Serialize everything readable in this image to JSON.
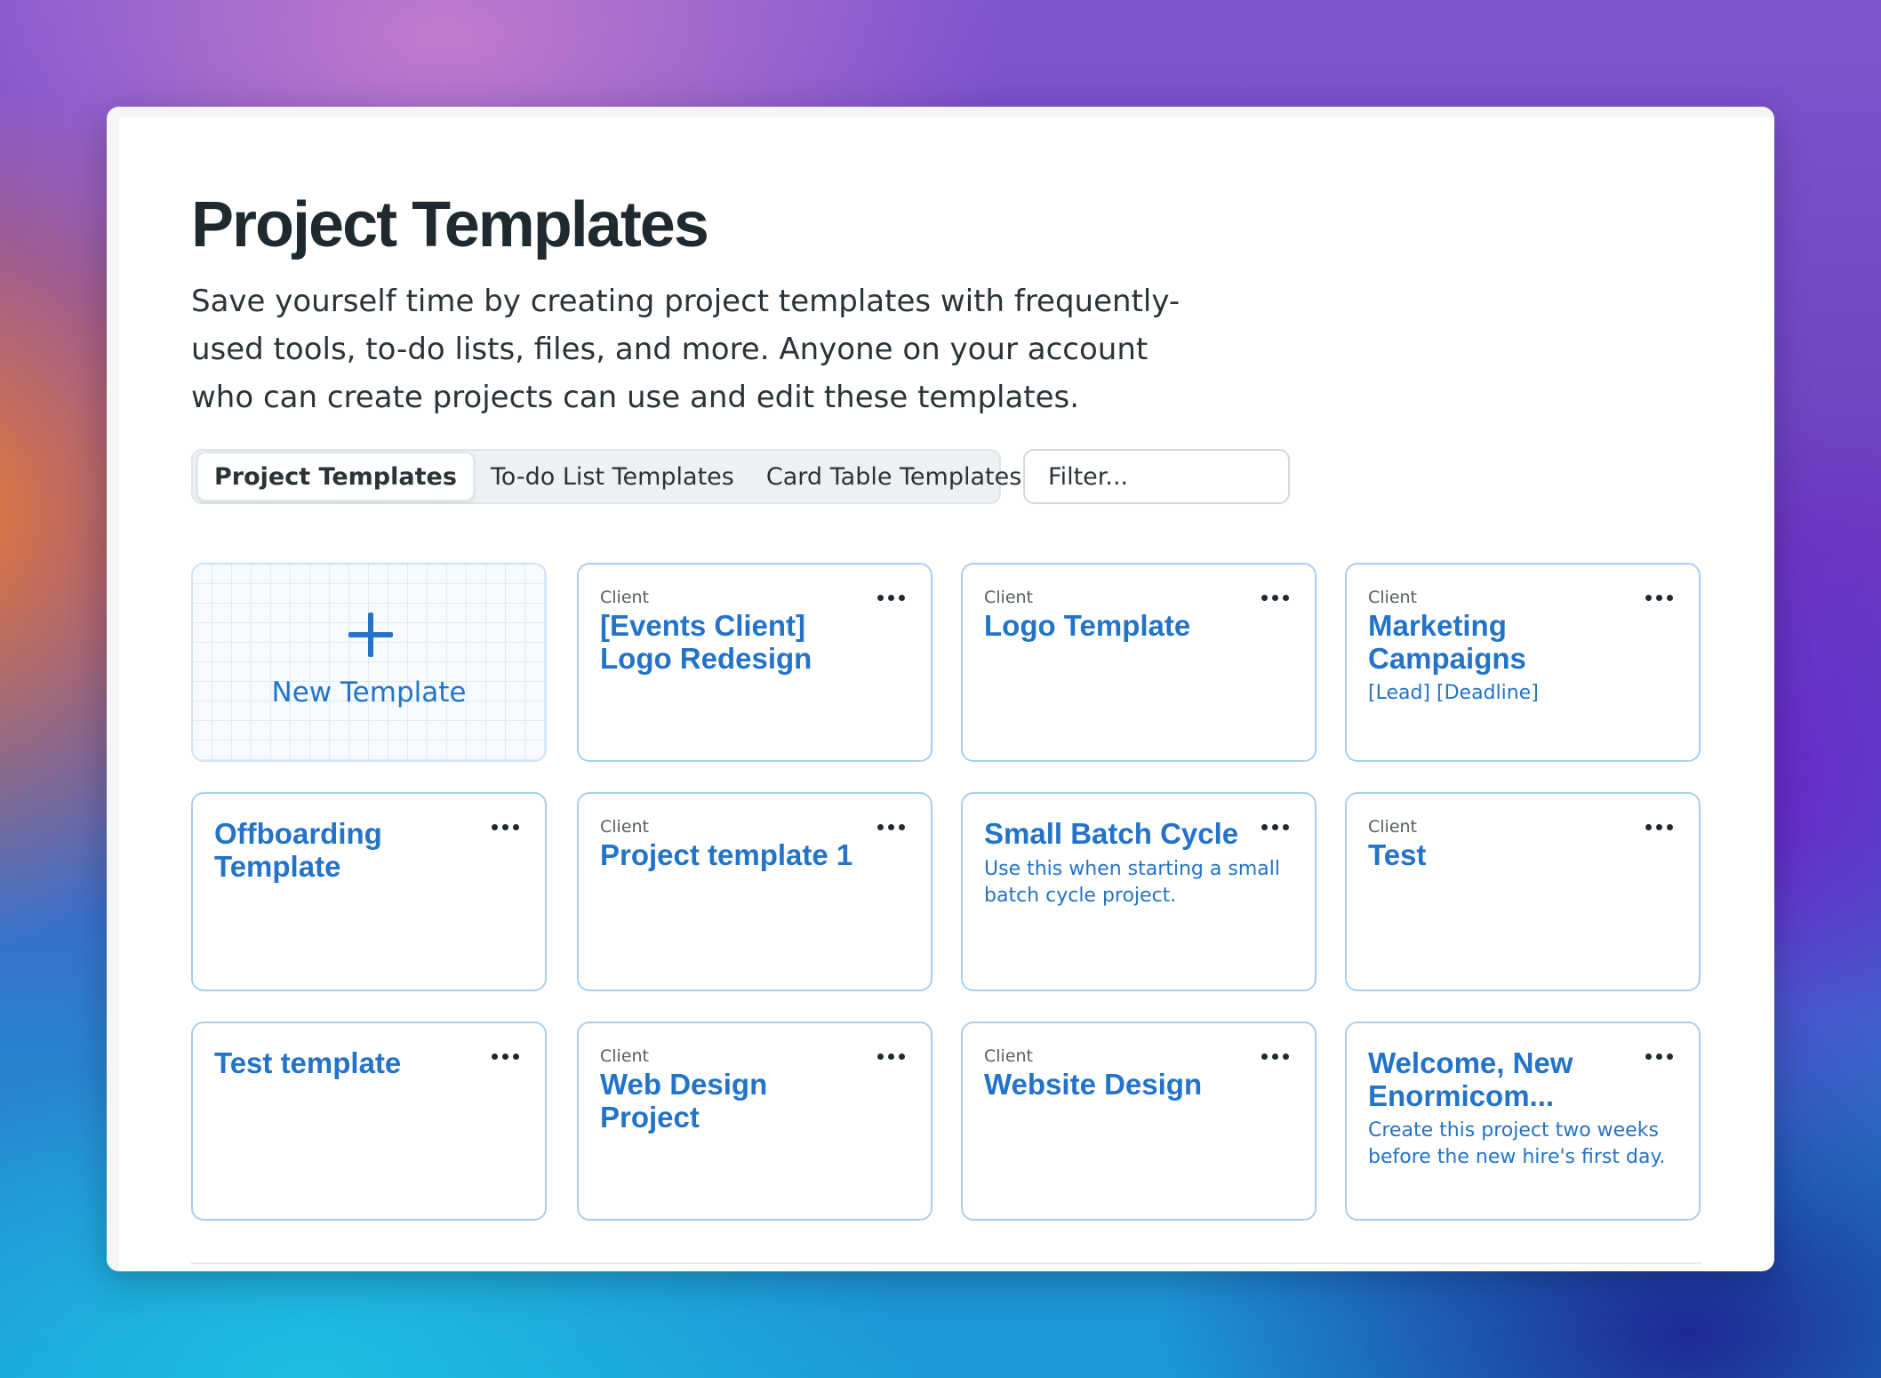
{
  "page": {
    "title": "Project Templates",
    "description": "Save yourself time by creating project templates with frequently-used tools, to-do lists, files, and more. Anyone on your account who can create projects can use and edit these templates."
  },
  "tabs": [
    {
      "label": "Project Templates",
      "active": true
    },
    {
      "label": "To-do List Templates",
      "active": false
    },
    {
      "label": "Card Table Templates",
      "active": false
    }
  ],
  "filter": {
    "placeholder": "Filter..."
  },
  "new_template": {
    "label": "New Template",
    "icon": "plus-icon"
  },
  "cards": [
    {
      "label": "Client",
      "title": "[Events Client] Logo Redesign",
      "desc": ""
    },
    {
      "label": "Client",
      "title": "Logo Template",
      "desc": ""
    },
    {
      "label": "Client",
      "title": "Marketing Campaigns",
      "desc": "[Lead] [Deadline]"
    },
    {
      "label": "",
      "title": "Offboarding Template",
      "desc": ""
    },
    {
      "label": "Client",
      "title": "Project template 1",
      "desc": ""
    },
    {
      "label": "",
      "title": "Small Batch Cycle",
      "desc": "Use this when starting a small batch cycle project."
    },
    {
      "label": "Client",
      "title": "Test",
      "desc": ""
    },
    {
      "label": "",
      "title": "Test template",
      "desc": ""
    },
    {
      "label": "Client",
      "title": "Web Design Project",
      "desc": ""
    },
    {
      "label": "Client",
      "title": "Website Design",
      "desc": ""
    },
    {
      "label": "",
      "title": "Welcome, New Enormicom...",
      "desc": "Create this project two weeks before the new hire's first day."
    }
  ],
  "colors": {
    "accent": "#2273c9",
    "title_text": "#1f2a30",
    "card_border": "#a9cfee"
  }
}
